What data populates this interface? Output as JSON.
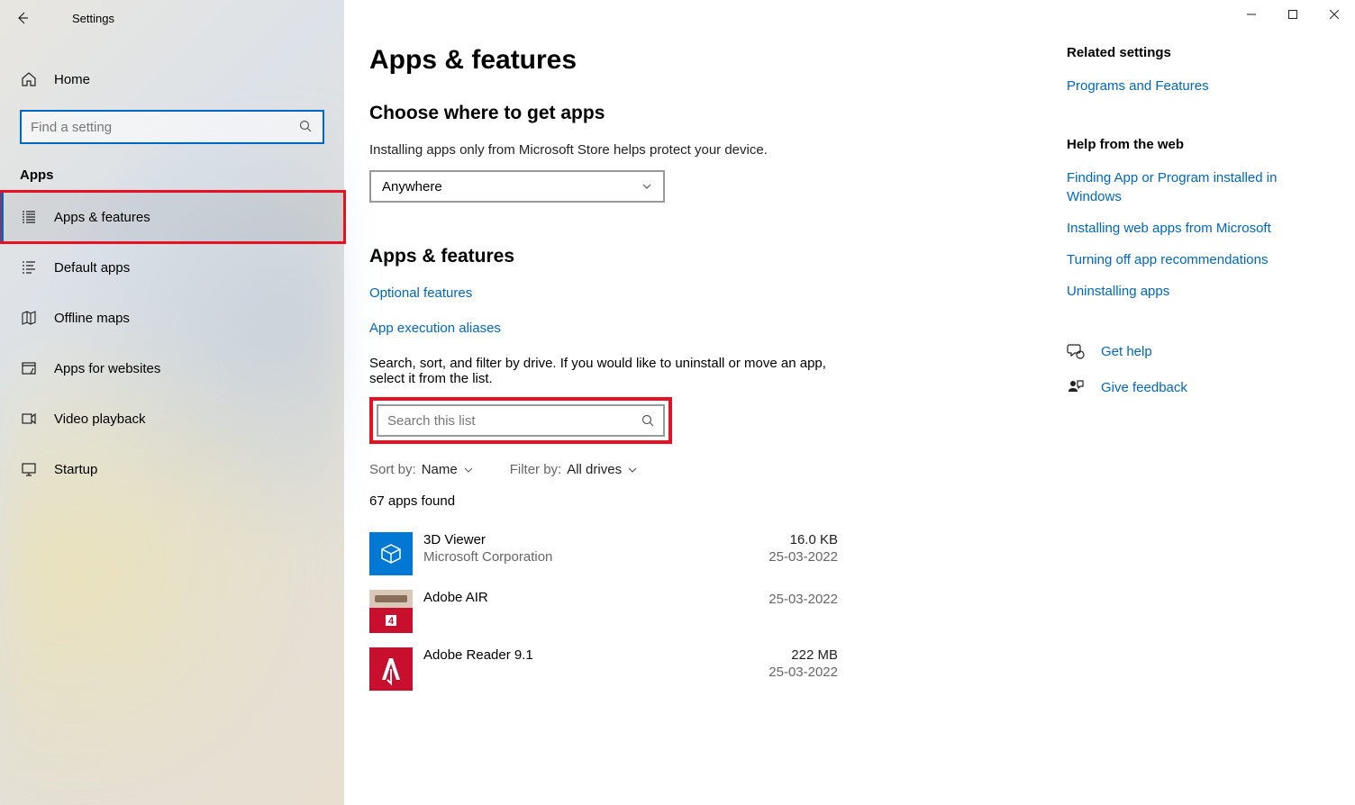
{
  "window": {
    "title": "Settings"
  },
  "sidebar": {
    "home": "Home",
    "search_placeholder": "Find a setting",
    "category": "Apps",
    "items": [
      {
        "label": "Apps & features"
      },
      {
        "label": "Default apps"
      },
      {
        "label": "Offline maps"
      },
      {
        "label": "Apps for websites"
      },
      {
        "label": "Video playback"
      },
      {
        "label": "Startup"
      }
    ]
  },
  "main": {
    "title": "Apps & features",
    "section1": {
      "heading": "Choose where to get apps",
      "subtext": "Installing apps only from Microsoft Store helps protect your device.",
      "dropdown_value": "Anywhere"
    },
    "section2": {
      "heading": "Apps & features",
      "link1": "Optional features",
      "link2": "App execution aliases",
      "filter_text": "Search, sort, and filter by drive. If you would like to uninstall or move an app, select it from the list.",
      "search_placeholder": "Search this list",
      "sort_label": "Sort by:",
      "sort_value": "Name",
      "filter_label": "Filter by:",
      "filter_value": "All drives",
      "count": "67 apps found",
      "apps": [
        {
          "name": "3D Viewer",
          "publisher": "Microsoft Corporation",
          "size": "16.0 KB",
          "date": "25-03-2022",
          "icon_bg": "#0078d4"
        },
        {
          "name": "Adobe AIR",
          "publisher": "",
          "size": "",
          "date": "25-03-2022",
          "icon_bg": "#c94f2e"
        },
        {
          "name": "Adobe Reader 9.1",
          "publisher": "",
          "size": "222 MB",
          "date": "25-03-2022",
          "icon_bg": "#c8102e"
        }
      ]
    }
  },
  "right": {
    "related": {
      "heading": "Related settings",
      "links": [
        "Programs and Features"
      ]
    },
    "help": {
      "heading": "Help from the web",
      "links": [
        "Finding App or Program installed in Windows",
        "Installing web apps from Microsoft",
        "Turning off app recommendations",
        "Uninstalling apps"
      ]
    },
    "actions": {
      "get_help": "Get help",
      "give_feedback": "Give feedback"
    }
  }
}
